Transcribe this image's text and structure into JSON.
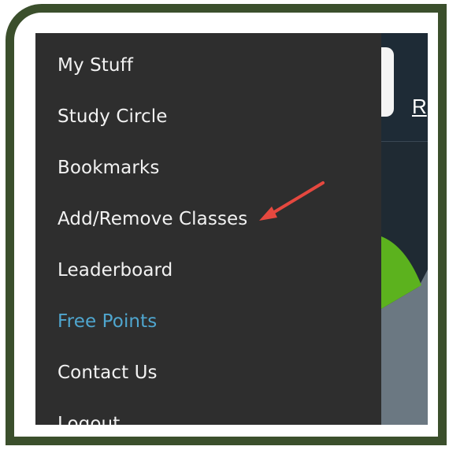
{
  "menu": {
    "items": [
      {
        "label": "My Stuff"
      },
      {
        "label": "Study Circle"
      },
      {
        "label": "Bookmarks"
      },
      {
        "label": "Add/Remove Classes"
      },
      {
        "label": "Leaderboard"
      },
      {
        "label": "Free Points"
      },
      {
        "label": "Contact Us"
      },
      {
        "label": "Logout"
      }
    ]
  },
  "background": {
    "link_label": "R"
  },
  "colors": {
    "frame": "#3b4f2c",
    "menu_bg": "#2e2e2e",
    "highlight": "#4fa6cf",
    "annotation_arrow": "#e5483f",
    "chart_green": "#5cb21e",
    "chart_gray": "#6b7882"
  }
}
